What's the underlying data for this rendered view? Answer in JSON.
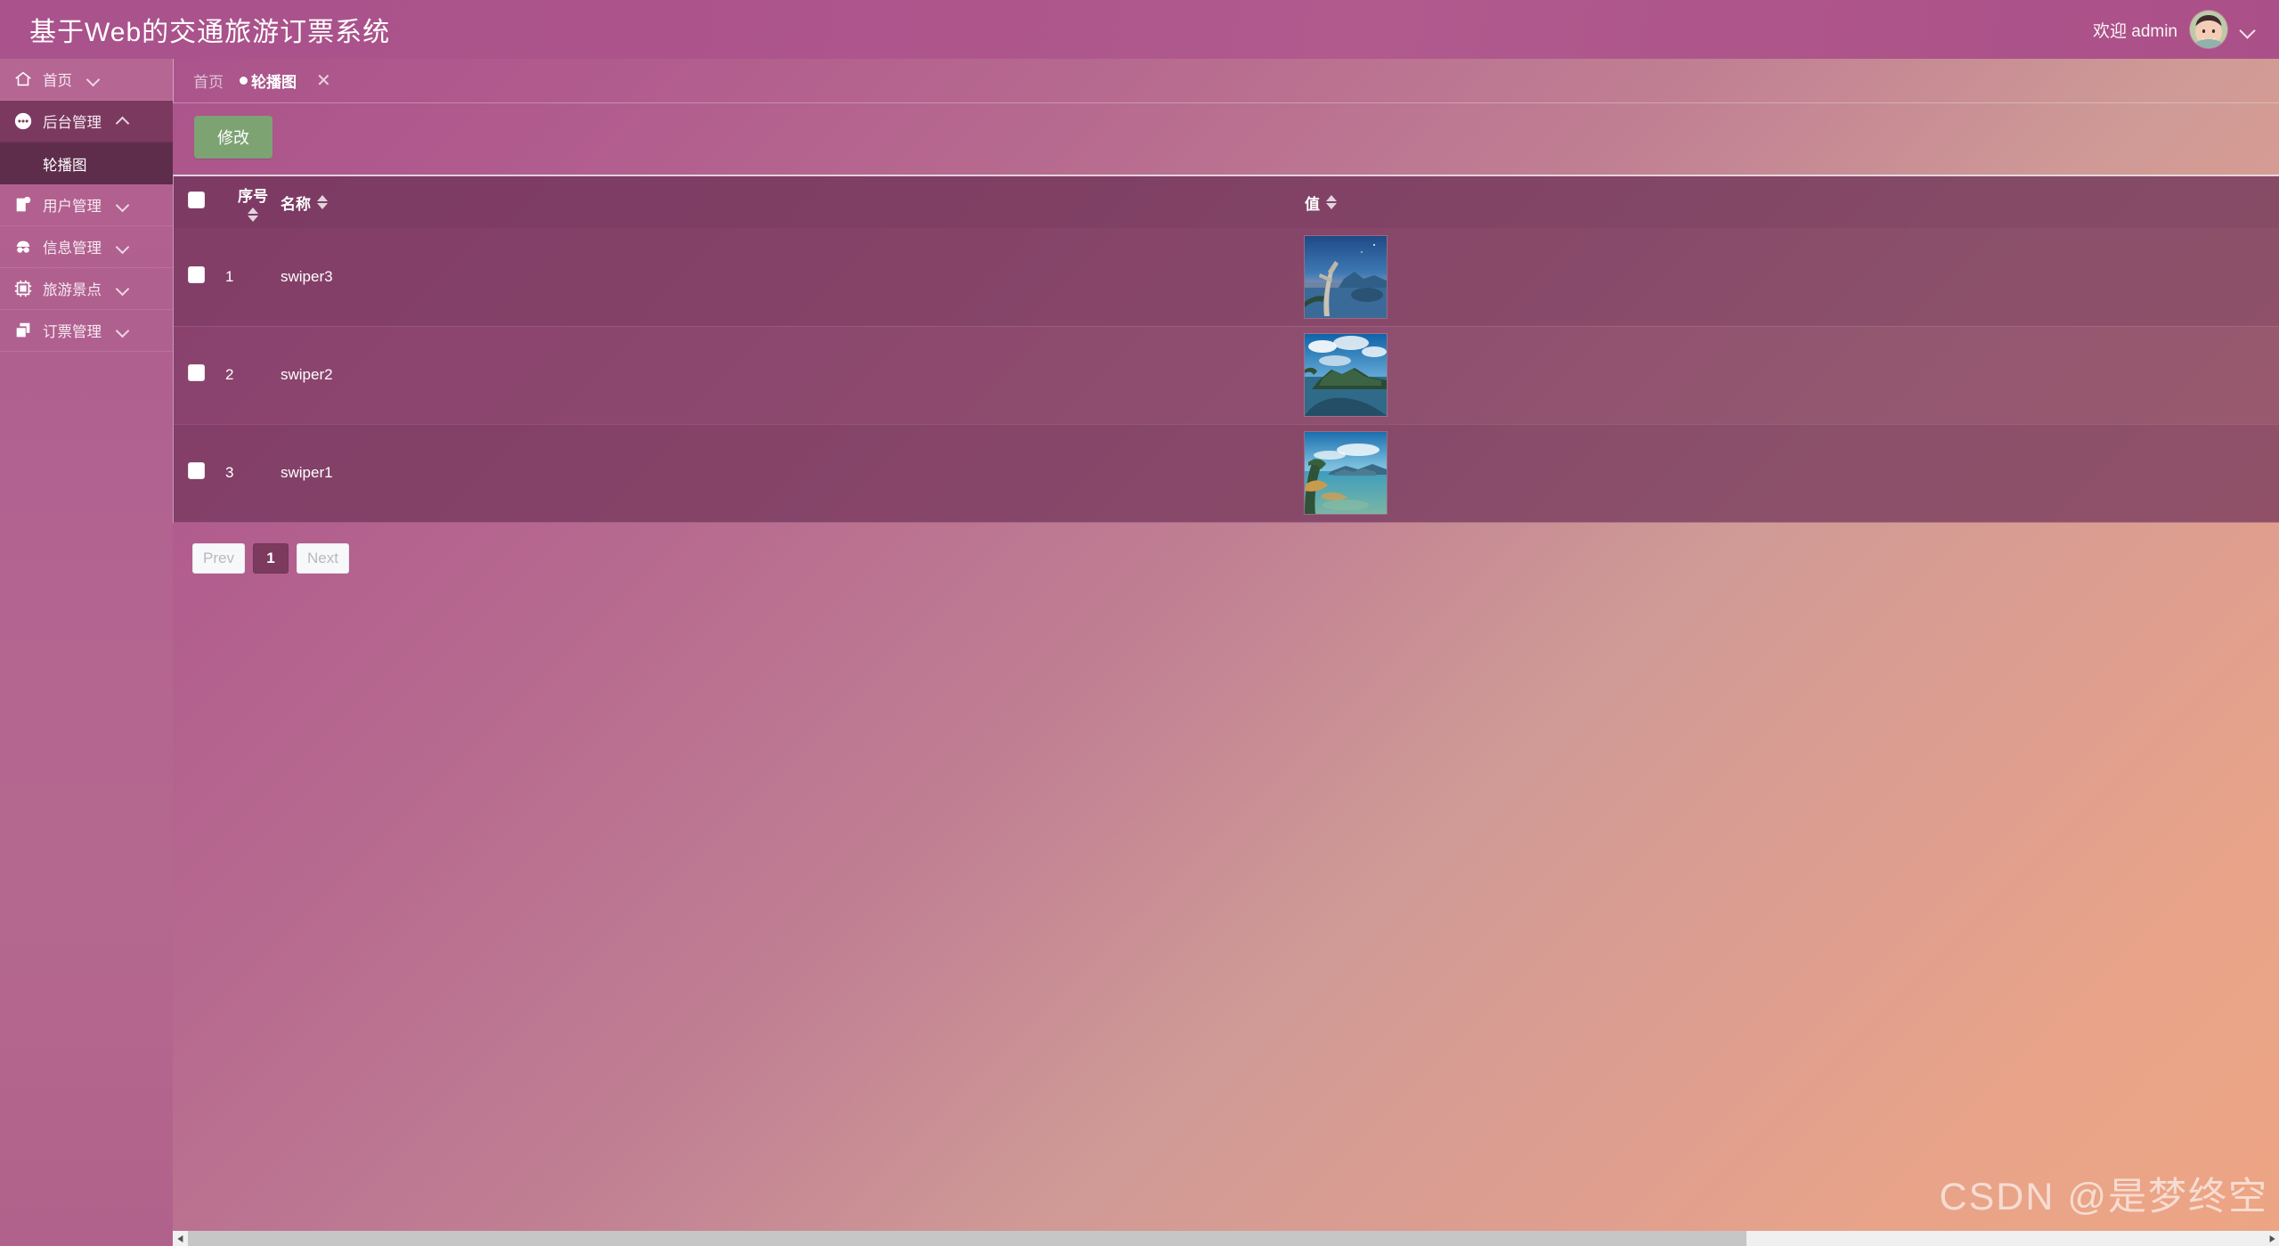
{
  "header": {
    "title": "基于Web的交通旅游订票系统",
    "welcome": "欢迎 admin",
    "avatar_icon": "user-avatar-image",
    "dropdown_icon": "chevron-down-icon",
    "brand_color": "#a9528b"
  },
  "sidebar": {
    "items": [
      {
        "label": "首页",
        "icon": "home-icon",
        "chevron": "chevron-down-icon",
        "state": "collapsed"
      },
      {
        "label": "后台管理",
        "icon": "dots-circle-icon",
        "chevron": "chevron-up-icon",
        "state": "expanded"
      },
      {
        "label": "用户管理",
        "icon": "note-badge-icon",
        "chevron": "chevron-down-icon",
        "state": "collapsed"
      },
      {
        "label": "信息管理",
        "icon": "incognito-glasses-icon",
        "chevron": "chevron-down-icon",
        "state": "collapsed"
      },
      {
        "label": "旅游景点",
        "icon": "chip-icon",
        "chevron": "chevron-down-icon",
        "state": "collapsed"
      },
      {
        "label": "订票管理",
        "icon": "copy-layers-icon",
        "chevron": "chevron-down-icon",
        "state": "collapsed"
      }
    ],
    "sub_item": {
      "label": "轮播图",
      "active": true
    }
  },
  "tabs": [
    {
      "label": "首页",
      "active": false,
      "closable": false
    },
    {
      "label": "轮播图",
      "active": true,
      "closable": true,
      "close_icon": "close-icon",
      "dot": "●"
    }
  ],
  "toolbar": {
    "modify_label": "修改",
    "modify_color": "#7da373"
  },
  "table": {
    "headers": {
      "select_all": "select-all-checkbox",
      "index": "序号",
      "name": "名称",
      "value": "值"
    },
    "sort_icon": "sort-arrows-icon",
    "rows": [
      {
        "checked": false,
        "index": "1",
        "name": "swiper3",
        "value_icon": "thumbnail-image-swiper3"
      },
      {
        "checked": false,
        "index": "2",
        "name": "swiper2",
        "value_icon": "thumbnail-image-swiper2"
      },
      {
        "checked": false,
        "index": "3",
        "name": "swiper1",
        "value_icon": "thumbnail-image-swiper1"
      }
    ]
  },
  "pagination": {
    "prev_label": "Prev",
    "next_label": "Next",
    "pages": [
      "1"
    ],
    "current_page": "1",
    "prev_disabled": true,
    "next_disabled": true
  },
  "watermark": "CSDN @是梦终空",
  "scrollbar": {
    "left_arrow_icon": "triangle-left-icon",
    "right_arrow_icon": "triangle-right-icon"
  }
}
